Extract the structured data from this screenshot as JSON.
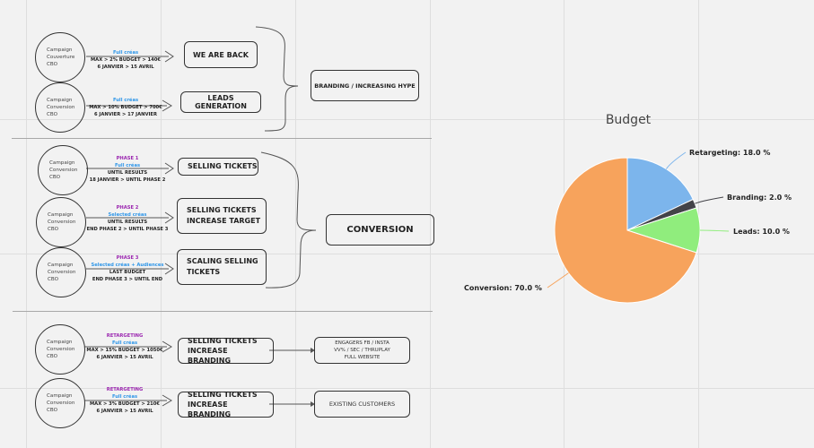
{
  "sections": [
    {
      "name": "branding",
      "campaigns": [
        {
          "circle": [
            "Campaign",
            "Couverture",
            "CBO"
          ],
          "phase": "",
          "creas": "Full créas",
          "line1": "MAX > 2% BUDGET > 140€",
          "line2": "6 JANVIER > 15 AVRIL",
          "action": [
            "WE ARE BACK"
          ]
        },
        {
          "circle": [
            "Campaign",
            "Conversion",
            "CBO"
          ],
          "phase": "",
          "creas": "Full créas",
          "line1": "MAX > 10% BUDGET > 700€",
          "line2": "6 JANVIER > 17 JANVIER",
          "action": [
            "LEADS GENERATION"
          ]
        }
      ],
      "goal": "BRANDING / INCREASING HYPE"
    },
    {
      "name": "conversion",
      "campaigns": [
        {
          "circle": [
            "Campaign",
            "Conversion",
            "CBO"
          ],
          "phase": "PHASE 1",
          "creas": "Full créas",
          "line1": "UNTIL RESULTS",
          "line2": "18 JANVIER > UNTIL PHASE 2",
          "action": [
            "SELLING TICKETS"
          ]
        },
        {
          "circle": [
            "Campaign",
            "Conversion",
            "CBO"
          ],
          "phase": "PHASE 2",
          "creas": "Selected créas",
          "line1": "UNTIL RESULTS",
          "line2": "END PHASE 2 > UNTIL PHASE 3",
          "action": [
            "SELLING TICKETS",
            "INCREASE TARGET"
          ]
        },
        {
          "circle": [
            "Campaign",
            "Conversion",
            "CBO"
          ],
          "phase": "PHASE 3",
          "creas": "Selected créas + Audiences",
          "line1": "LAST BUDGET",
          "line2": "END PHASE 3 > UNTIL END",
          "action": [
            "SCALING SELLING",
            "TICKETS"
          ]
        }
      ],
      "goal": "CONVERSION"
    },
    {
      "name": "retargeting",
      "campaigns": [
        {
          "circle": [
            "Campaign",
            "Conversion",
            "CBO"
          ],
          "phase": "RETARGETING",
          "creas": "Full créas",
          "line1": "MAX > 15% BUDGET > 1050€",
          "line2": "6 JANVIER > 15 AVRIL",
          "action": [
            "SELLING TICKETS",
            "INCREASE BRANDING"
          ],
          "audience": [
            "ENGAGERS FB / INSTA",
            "VV% / SEC / THRUPLAY",
            "FULL WEBSITE"
          ]
        },
        {
          "circle": [
            "Campaign",
            "Conversion",
            "CBO"
          ],
          "phase": "RETARGETING",
          "creas": "Full créas",
          "line1": "MAX > 3% BUDGET > 210€",
          "line2": "6 JANVIER > 15 AVRIL",
          "action": [
            "SELLING TICKETS",
            "INCREASE BRANDING"
          ],
          "audience": [
            "EXISTING CUSTOMERS"
          ]
        }
      ]
    }
  ],
  "colors": {
    "phase": "#9b27b0",
    "creas": "#2f96e8"
  },
  "chart_data": {
    "type": "pie",
    "title": "Budget",
    "start_angle": "top, clockwise",
    "slices": [
      {
        "label": "Retargeting",
        "value": 18.0,
        "display": "Retargeting: 18.0 %",
        "color": "#7cb5ec"
      },
      {
        "label": "Branding",
        "value": 2.0,
        "display": "Branding: 2.0 %",
        "color": "#434348"
      },
      {
        "label": "Leads",
        "value": 10.0,
        "display": "Leads: 10.0 %",
        "color": "#90ed7d"
      },
      {
        "label": "Conversion",
        "value": 70.0,
        "display": "Conversion: 70.0 %",
        "color": "#f7a35c"
      }
    ]
  }
}
